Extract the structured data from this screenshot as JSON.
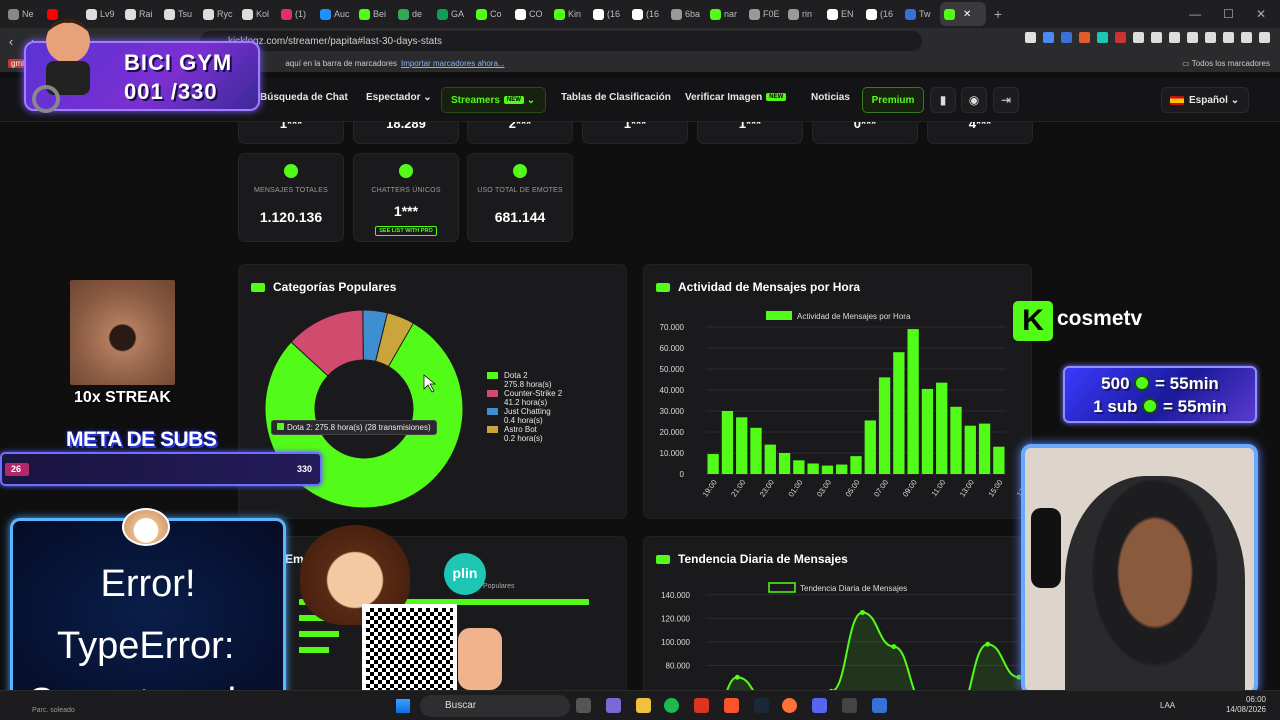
{
  "browser": {
    "tabs": [
      {
        "label": "Ne",
        "fav": "#888"
      },
      {
        "label": "",
        "fav": "#ff0000"
      },
      {
        "label": "Lv9",
        "fav": "#ddd"
      },
      {
        "label": "Rai",
        "fav": "#ddd"
      },
      {
        "label": "Tsu",
        "fav": "#ddd"
      },
      {
        "label": "Ryc",
        "fav": "#ddd"
      },
      {
        "label": "Kol",
        "fav": "#ddd"
      },
      {
        "label": "(1)",
        "fav": "#e1306c"
      },
      {
        "label": "Auc",
        "fav": "#1e90ff"
      },
      {
        "label": "Bei",
        "fav": "#53fc18"
      },
      {
        "label": "de",
        "fav": "#34a853"
      },
      {
        "label": "GA",
        "fav": "#0f9d58"
      },
      {
        "label": "Co",
        "fav": "#53fc18"
      },
      {
        "label": "CO",
        "fav": "#fff"
      },
      {
        "label": "Kin",
        "fav": "#53fc18"
      },
      {
        "label": "(16",
        "fav": "#fff"
      },
      {
        "label": "(16",
        "fav": "#fff"
      },
      {
        "label": "6ba",
        "fav": "#999"
      },
      {
        "label": "nar",
        "fav": "#53fc18"
      },
      {
        "label": "F0E",
        "fav": "#999"
      },
      {
        "label": "rin",
        "fav": "#999"
      },
      {
        "label": "EN",
        "fav": "#fff"
      },
      {
        "label": "(16",
        "fav": "#fff"
      },
      {
        "label": "Tw",
        "fav": "#3a6fd8"
      },
      {
        "label": "",
        "fav": "#53fc18",
        "active": true
      }
    ],
    "url": "kicklogz.com/streamer/papita#last-30-days-stats",
    "bookmarks_hint": "aquí en la barra de marcadores",
    "bookmarks_import": "Importar marcadores ahora...",
    "bookmarks_all": "Todos los marcadores",
    "bookmark_tag": "gmt",
    "win_minimize": "—",
    "win_maximize": "☐",
    "win_close": "✕"
  },
  "nav": {
    "chat_search": "Búsqueda de Chat",
    "viewer": "Espectador",
    "streamers": "Streamers",
    "new_badge": "NEW",
    "leaderboards": "Tablas de Clasificación",
    "verify_image": "Verificar Imagen",
    "news": "Noticias",
    "premium": "Premium",
    "language": "Español"
  },
  "top_stats": [
    "1***",
    "18.289",
    "2***",
    "1***",
    "1***",
    "0***",
    "4***"
  ],
  "stats": {
    "total_messages": {
      "label": "MENSAJES TOTALES",
      "value": "1.120.136"
    },
    "unique_chatters": {
      "label": "CHATTERS ÚNICOS",
      "value": "1***",
      "link": "SEE LIST WITH PRO"
    },
    "emote_usage": {
      "label": "USO TOTAL DE EMOTES",
      "value": "681.144"
    }
  },
  "categories_panel": {
    "title": "Categorías Populares",
    "tooltip": "Dota 2: 275.8 hora(s) (28 transmisiones)"
  },
  "hourly_panel": {
    "title": "Actividad de Mensajes por Hora"
  },
  "daily_panel": {
    "title": "Tendencia Diaria de Mensajes"
  },
  "emotes_panel": {
    "title": "Emotes",
    "legend": "Populares"
  },
  "chart_data": [
    {
      "type": "pie",
      "title": "Categorías Populares",
      "categories": [
        "Dota 2",
        "Counter-Strike 2",
        "Just Chatting",
        "Astro Bot"
      ],
      "values": [
        275.8,
        41.2,
        0.4,
        0.2
      ],
      "value_labels": [
        "275.8 hora(s)",
        "41.2 hora(s)",
        "0.4 hora(s)",
        "0.2 hora(s)"
      ],
      "colors": [
        "#53fc18",
        "#d14b6e",
        "#3d8fd1",
        "#c9a53c"
      ],
      "legend": "right"
    },
    {
      "type": "bar",
      "title": "Actividad de Mensajes por Hora",
      "series": [
        {
          "name": "Actividad de Mensajes por Hora",
          "values": [
            9500,
            30000,
            27000,
            22000,
            14000,
            10000,
            6500,
            5000,
            4000,
            4500,
            8500,
            25500,
            46000,
            58000,
            69000,
            40500,
            43500,
            32000,
            23000,
            24000,
            13000
          ]
        }
      ],
      "categories": [
        "19:00",
        "20:00",
        "21:00",
        "22:00",
        "23:00",
        "00:00",
        "01:00",
        "02:00",
        "03:00",
        "04:00",
        "05:00",
        "06:00",
        "07:00",
        "08:00",
        "09:00",
        "10:00",
        "11:00",
        "12:00",
        "13:00",
        "14:00",
        "15:00",
        "16:00",
        "17:00"
      ],
      "tick_labels": [
        "19:00",
        "21:00",
        "23:00",
        "01:00",
        "03:00",
        "05:00",
        "07:00",
        "09:00",
        "11:00",
        "13:00",
        "15:00",
        "17:00"
      ],
      "yticks": [
        "0",
        "10.000",
        "20.000",
        "30.000",
        "40.000",
        "50.000",
        "60.000",
        "70.000"
      ],
      "ylim": [
        0,
        70000
      ],
      "color": "#53fc18"
    },
    {
      "type": "area",
      "title": "Tendencia Diaria de Mensajes",
      "series": [
        {
          "name": "Tendencia Diaria de Mensajes",
          "values": [
            10000,
            70000,
            48000,
            55000,
            58000,
            125000,
            96000,
            48000,
            40000,
            98000,
            70000
          ]
        }
      ],
      "yticks": [
        "80.000",
        "100.000",
        "120.000",
        "140.000"
      ],
      "ylim": [
        60000,
        150000
      ],
      "color": "#53fc18"
    }
  ],
  "overlays": {
    "gym_title": "BICI GYM",
    "gym_count": "001 /330",
    "streak": "10x STREAK",
    "subs_goal": "META DE SUBS",
    "subs_current": "26",
    "subs_target": "330",
    "error_title": "Error!",
    "error_msg": "TypeError:",
    "error_msg2": "Cannot read",
    "channel": "cosmetv",
    "kick_letter": "K",
    "rate1_amount": "500",
    "rate1_time": "= 55min",
    "rate2_amount": "1 sub",
    "rate2_time": "= 55min",
    "plin": "plin"
  },
  "taskbar": {
    "search": "Buscar",
    "hint": "Parc. soleado",
    "lang": "LAA",
    "time": "06:00",
    "date": "14/08/2026"
  }
}
